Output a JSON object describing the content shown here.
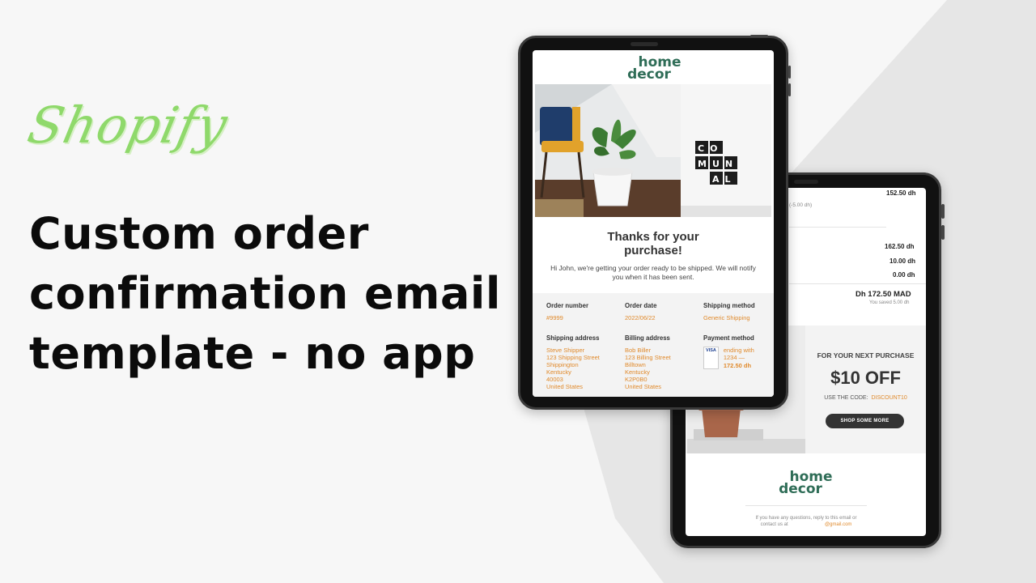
{
  "brand_script": "Shopify",
  "headline": {
    "line1": "Custom order",
    "line2": "confirmation email",
    "line3": "template - no app"
  },
  "email": {
    "logo_line1": "home",
    "logo_line2": "decor",
    "hero_sign": [
      "CO",
      "MUN",
      "AL"
    ],
    "thanks_line1": "Thanks for your",
    "thanks_line2": "purchase!",
    "message": "Hi John, we're getting your order ready to be shipped. We will notify you when it has been sent.",
    "order_number_label": "Order number",
    "order_number": "#9999",
    "order_date_label": "Order date",
    "order_date": "2022/06/22",
    "shipping_method_label": "Shipping method",
    "shipping_method": "Generic Shipping",
    "shipping_address_label": "Shipping address",
    "shipping_address": [
      "Steve Shipper",
      "123 Shipping Street",
      "Shippington",
      "Kentucky",
      "40003",
      "United States"
    ],
    "billing_address_label": "Billing address",
    "billing_address": [
      "Bob Biller",
      "123 Billing Street",
      "Billtown",
      "Kentucky",
      "K2P0B0",
      "United States"
    ],
    "payment_method_label": "Payment method",
    "card_brand": "VISA",
    "card_ending": "ending with",
    "card_digits": "1234 —",
    "payment_amount": "172.50 dh"
  },
  "back_email": {
    "line_total": "152.50 dh",
    "discount_note": "(-5.00 dh)",
    "subtotal": "162.50 dh",
    "shipping": "10.00 dh",
    "taxes": "0.00 dh",
    "total": "Dh 172.50 MAD",
    "saved": "You saved 5.00 dh",
    "promo_kicker": "FOR YOUR NEXT PURCHASE",
    "promo_big": "$10 OFF",
    "promo_code_label": "USE THE CODE:",
    "promo_code": "DISCOUNT10",
    "promo_button": "SHOP SOME MORE",
    "logo_line1": "home",
    "logo_line2": "decor",
    "footer_line1": "If you have any questions, reply to this email or",
    "footer_line2_prefix": "contact us at",
    "footer_email": "@gmail.com"
  },
  "colors": {
    "accent_green": "#2f6d57",
    "script_green": "#8fd96b",
    "orange": "#e08a2c"
  }
}
